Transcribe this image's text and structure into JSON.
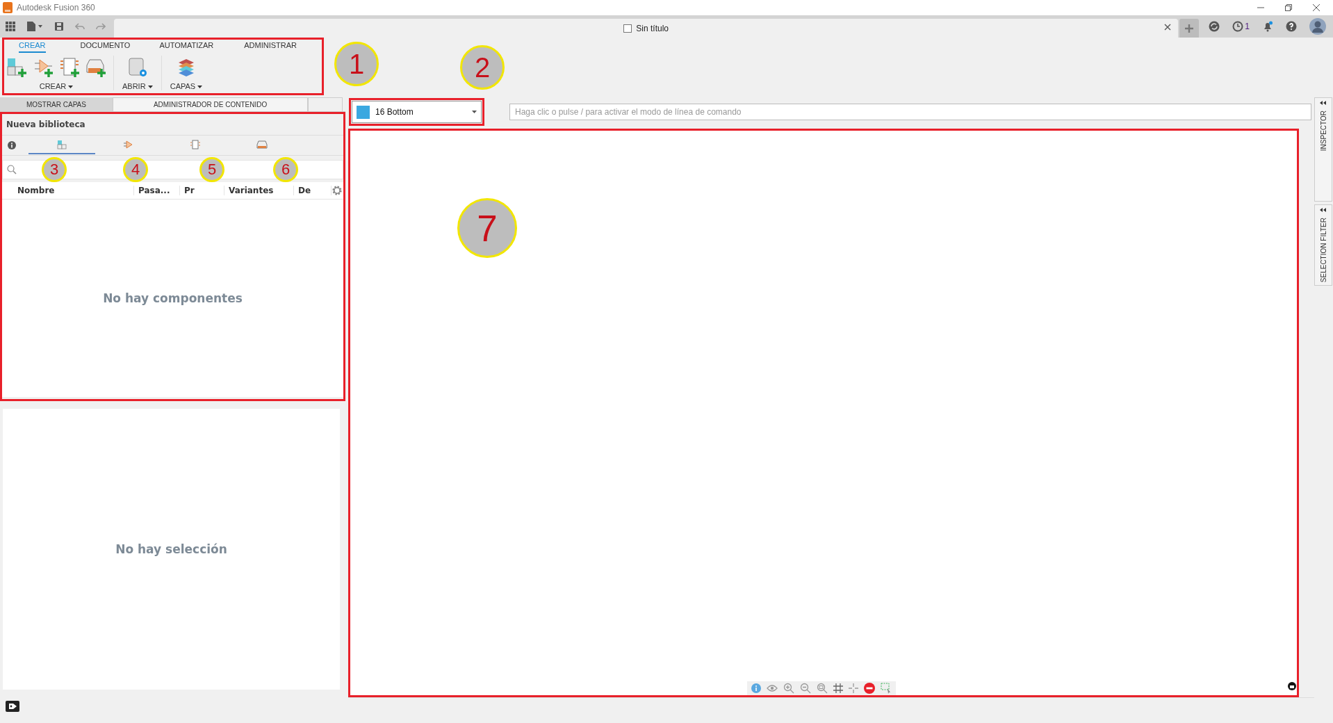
{
  "window": {
    "title": "Autodesk Fusion 360"
  },
  "document": {
    "title": "Sin título",
    "jobs_count": "1"
  },
  "ribbon": {
    "callout": "1",
    "tabs": [
      {
        "label": "CREAR",
        "selected": true
      },
      {
        "label": "DOCUMENTO",
        "selected": false
      },
      {
        "label": "AUTOMATIZAR",
        "selected": false
      },
      {
        "label": "ADMINISTRAR",
        "selected": false
      }
    ],
    "groups": [
      {
        "label": "CREAR",
        "kind": "create"
      },
      {
        "label": "ABRIR",
        "kind": "open"
      },
      {
        "label": "CAPAS",
        "kind": "layers"
      }
    ]
  },
  "panel_tabs": [
    {
      "label": "MOSTRAR CAPAS",
      "selected": false
    },
    {
      "label": "ADMINISTRADOR DE CONTENIDO",
      "selected": true
    }
  ],
  "library": {
    "title": "Nueva biblioteca",
    "tabs": [
      {
        "kind": "component",
        "selected": true,
        "callout": "3"
      },
      {
        "kind": "symbol",
        "selected": false,
        "callout": "4"
      },
      {
        "kind": "footprint",
        "selected": false,
        "callout": "5"
      },
      {
        "kind": "package",
        "selected": false,
        "callout": "6"
      }
    ],
    "columns": [
      "Nombre",
      "Pasa...",
      "Pr",
      "Variantes",
      "De"
    ],
    "empty_message": "No hay componentes"
  },
  "selection": {
    "empty_message": "No hay selección"
  },
  "layer_select": {
    "value": "16 Bottom",
    "callout": "2"
  },
  "command_line": {
    "placeholder": "Haga clic o pulse / para activar el modo de línea de comando"
  },
  "canvas": {
    "callout": "7"
  },
  "side_panels": [
    {
      "label": "INSPECTOR"
    },
    {
      "label": "SELECTION FILTER"
    }
  ]
}
